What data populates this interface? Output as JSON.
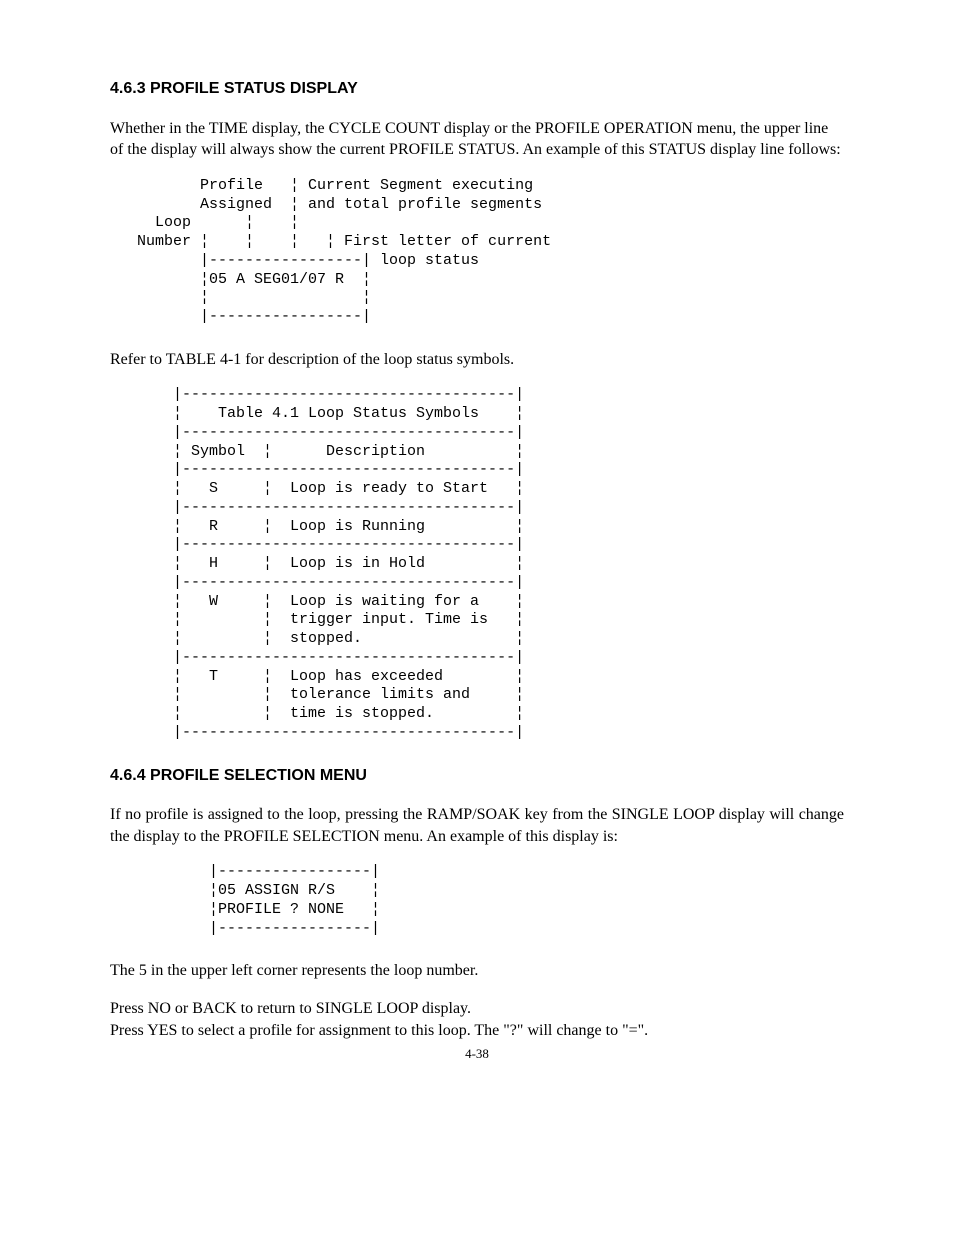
{
  "section1": {
    "heading": "4.6.3 PROFILE STATUS DISPLAY",
    "para1": "Whether in the TIME display, the CYCLE COUNT display or the PROFILE OPERATION menu, the upper line of the display will always show the current PROFILE STATUS. An example of this STATUS display line follows:",
    "diagram": "          Profile   ¦ Current Segment executing\n          Assigned  ¦ and total profile segments\n     Loop      ¦    ¦\n   Number ¦    ¦    ¦   ¦ First letter of current\n          |-----------------| loop status\n          ¦05 A SEG01/07 R  ¦\n          ¦                 ¦\n          |-----------------|",
    "para2": "Refer to TABLE 4-1 for description of the loop status symbols.",
    "table": "       |-------------------------------------|\n       ¦    Table 4.1 Loop Status Symbols    ¦\n       |-------------------------------------|\n       ¦ Symbol  ¦      Description          ¦\n       |-------------------------------------|\n       ¦   S     ¦  Loop is ready to Start   ¦\n       |-------------------------------------|\n       ¦   R     ¦  Loop is Running          ¦\n       |-------------------------------------|\n       ¦   H     ¦  Loop is in Hold          ¦\n       |-------------------------------------|\n       ¦   W     ¦  Loop is waiting for a    ¦\n       ¦         ¦  trigger input. Time is   ¦\n       ¦         ¦  stopped.                 ¦\n       |-------------------------------------|\n       ¦   T     ¦  Loop has exceeded        ¦\n       ¦         ¦  tolerance limits and     ¦\n       ¦         ¦  time is stopped.         ¦\n       |-------------------------------------|"
  },
  "section2": {
    "heading": "4.6.4 PROFILE SELECTION MENU",
    "para1": "If no profile is assigned to the loop, pressing the RAMP/SOAK key from the SINGLE LOOP display will change the display to the PROFILE SELECTION menu. An example of this display is:",
    "diagram": "           |-----------------|\n           ¦05 ASSIGN R/S    ¦\n           ¦PROFILE ? NONE   ¦\n           |-----------------|",
    "para2": "The 5 in the upper left corner represents the loop number.",
    "para3": "Press NO or BACK to return to SINGLE LOOP display.",
    "para4": "Press YES to select a profile for assignment to this loop. The \"?\" will change to  \"=\"."
  },
  "page_number": "4-38",
  "chart_data": {
    "type": "table",
    "title": "Table 4.1 Loop Status Symbols",
    "columns": [
      "Symbol",
      "Description"
    ],
    "rows": [
      [
        "S",
        "Loop is ready to Start"
      ],
      [
        "R",
        "Loop is Running"
      ],
      [
        "H",
        "Loop is in Hold"
      ],
      [
        "W",
        "Loop is waiting for a trigger input. Time is stopped."
      ],
      [
        "T",
        "Loop has exceeded tolerance limits and time is stopped."
      ]
    ]
  }
}
